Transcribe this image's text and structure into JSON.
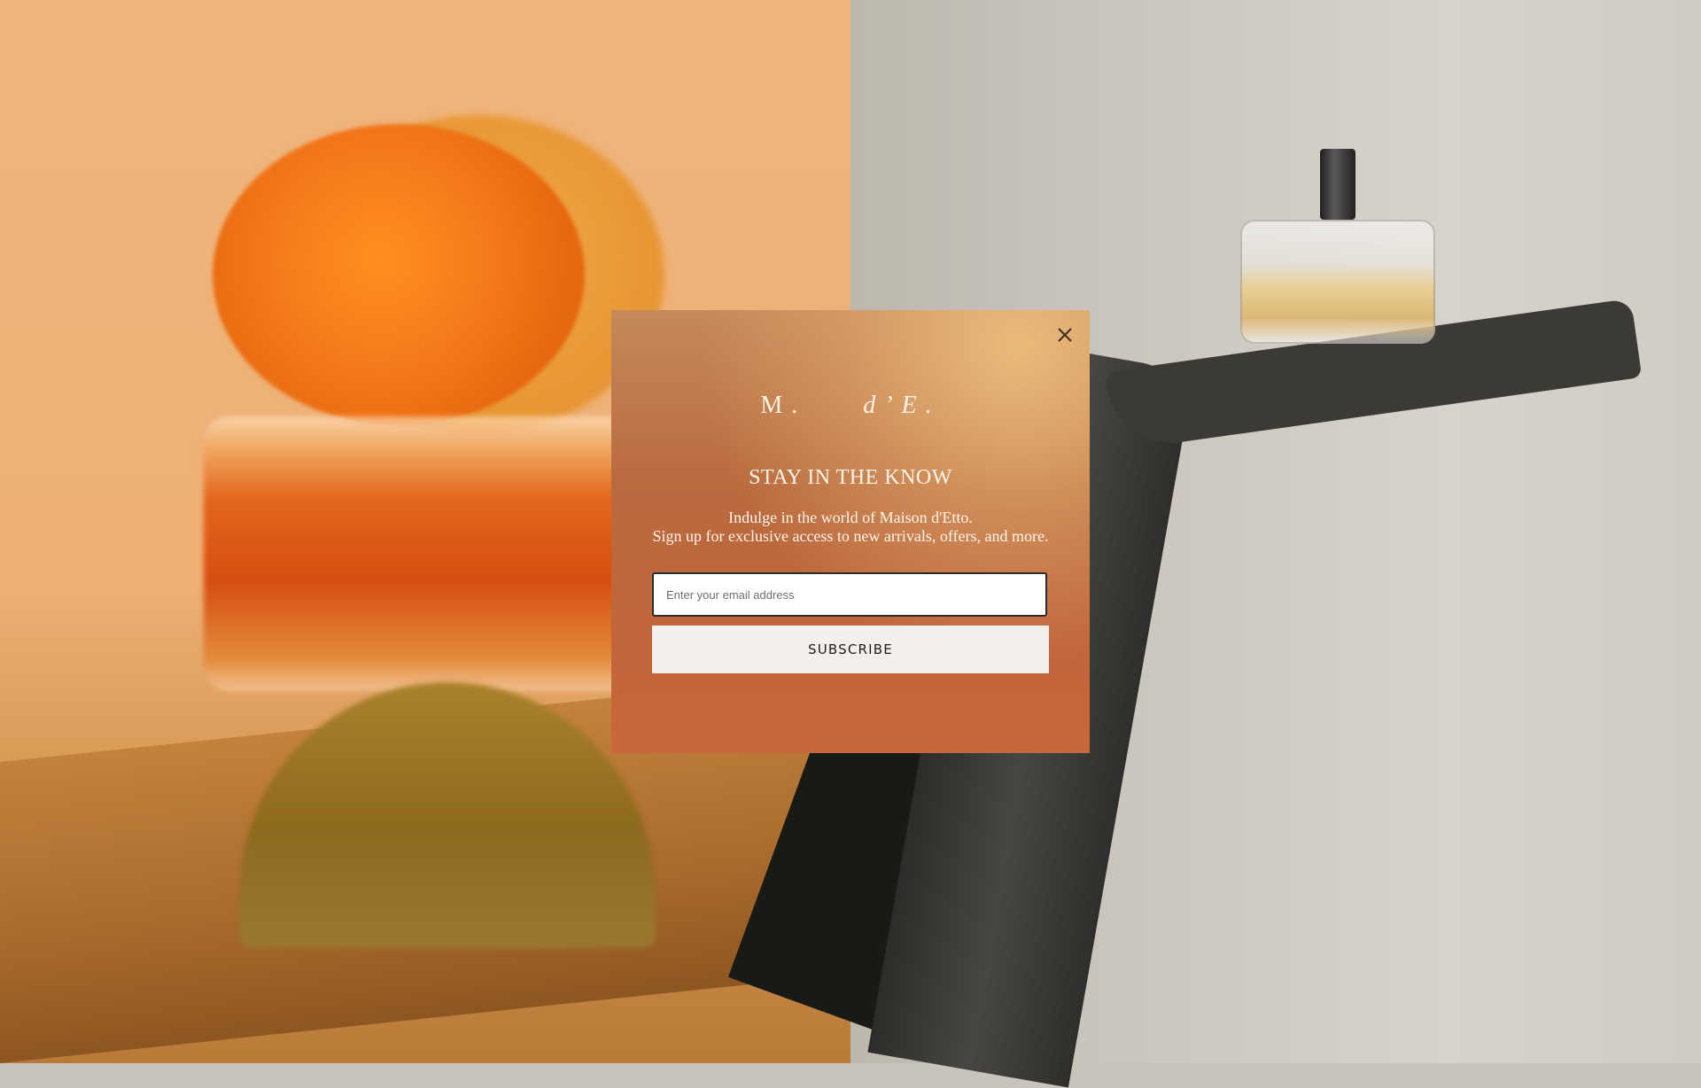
{
  "popup": {
    "logo_text_left": "M.",
    "logo_text_right": "d’E.",
    "headline": "STAY IN THE KNOW",
    "subtext_line1": "Indulge in the world of Maison d'Etto.",
    "subtext_line2": "Sign up for exclusive access to new arrivals, offers, and more.",
    "email_placeholder": "Enter your email address",
    "email_value": "",
    "subscribe_label": "SUBSCRIBE",
    "close_icon": "close-icon"
  },
  "colors": {
    "popup_gradient_top": "#c6895a",
    "popup_gradient_bottom": "#c8673a",
    "popup_text": "#fdf4ea",
    "button_bg": "#f3f0ec",
    "button_text": "#1d1d1d",
    "left_background": "#efb57c",
    "right_background": "#cbc7bf"
  }
}
